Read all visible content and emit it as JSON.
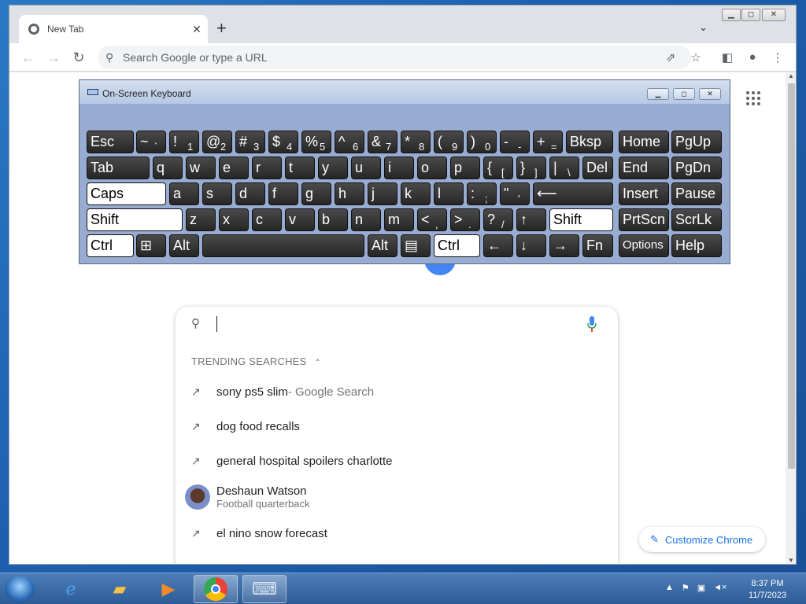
{
  "browser": {
    "tab_title": "New Tab",
    "omnibox_placeholder": "Search Google or type a URL"
  },
  "osk": {
    "title": "On-Screen Keyboard",
    "keys": {
      "esc": "Esc",
      "tilde": "~",
      "tilde_sub": "`",
      "k1": "!",
      "k1s": "1",
      "k2": "@",
      "k2s": "2",
      "k3": "#",
      "k3s": "3",
      "k4": "$",
      "k4s": "4",
      "k5": "%",
      "k5s": "5",
      "k6": "^",
      "k6s": "6",
      "k7": "&",
      "k7s": "7",
      "k8": "*",
      "k8s": "8",
      "k9": "(",
      "k9s": "9",
      "k0": ")",
      "k0s": "0",
      "minus": "-",
      "minus_s": "-",
      "plus": "+",
      "plus_s": "=",
      "bksp": "Bksp",
      "home": "Home",
      "pgup": "PgUp",
      "tab": "Tab",
      "q": "q",
      "w": "w",
      "e": "e",
      "r": "r",
      "t": "t",
      "y": "y",
      "u": "u",
      "i": "i",
      "o": "o",
      "p": "p",
      "lbr": "{",
      "lbr_s": "[",
      "rbr": "}",
      "rbr_s": "]",
      "pipe": "|",
      "pipe_s": "\\",
      "del": "Del",
      "end": "End",
      "pgdn": "PgDn",
      "caps": "Caps",
      "a": "a",
      "s": "s",
      "d": "d",
      "f": "f",
      "g": "g",
      "h": "h",
      "j": "j",
      "k": "k",
      "l": "l",
      "colon": ":",
      "colon_s": ";",
      "quote": "\"",
      "quote_s": "'",
      "enter": "⟵",
      "insert": "Insert",
      "pause": "Pause",
      "shift": "Shift",
      "z": "z",
      "x": "x",
      "c": "c",
      "v": "v",
      "b": "b",
      "n": "n",
      "m": "m",
      "lt": "<",
      "lt_s": ",",
      "gt": ">",
      "gt_s": ".",
      "q_mark": "?",
      "q_mark_s": "/",
      "up": "↑",
      "shift_r": "Shift",
      "prtscn": "PrtScn",
      "scrlk": "ScrLk",
      "ctrl": "Ctrl",
      "win": "⊞",
      "alt": "Alt",
      "alt_r": "Alt",
      "menu": "▤",
      "ctrl_r": "Ctrl",
      "left": "←",
      "down": "↓",
      "right": "→",
      "fn": "Fn",
      "options": "Options",
      "help": "Help"
    }
  },
  "search": {
    "trending_label": "TRENDING SEARCHES",
    "items": [
      {
        "text": "sony ps5 slim",
        "suffix": " - Google Search"
      },
      {
        "text": "dog food recalls"
      },
      {
        "text": "general hospital spoilers charlotte"
      },
      {
        "text": "Deshaun Watson",
        "subtitle": "Football quarterback"
      },
      {
        "text": "el nino snow forecast"
      }
    ]
  },
  "customize_label": "Customize Chrome",
  "clock": {
    "time": "8:37 PM",
    "date": "11/7/2023"
  }
}
